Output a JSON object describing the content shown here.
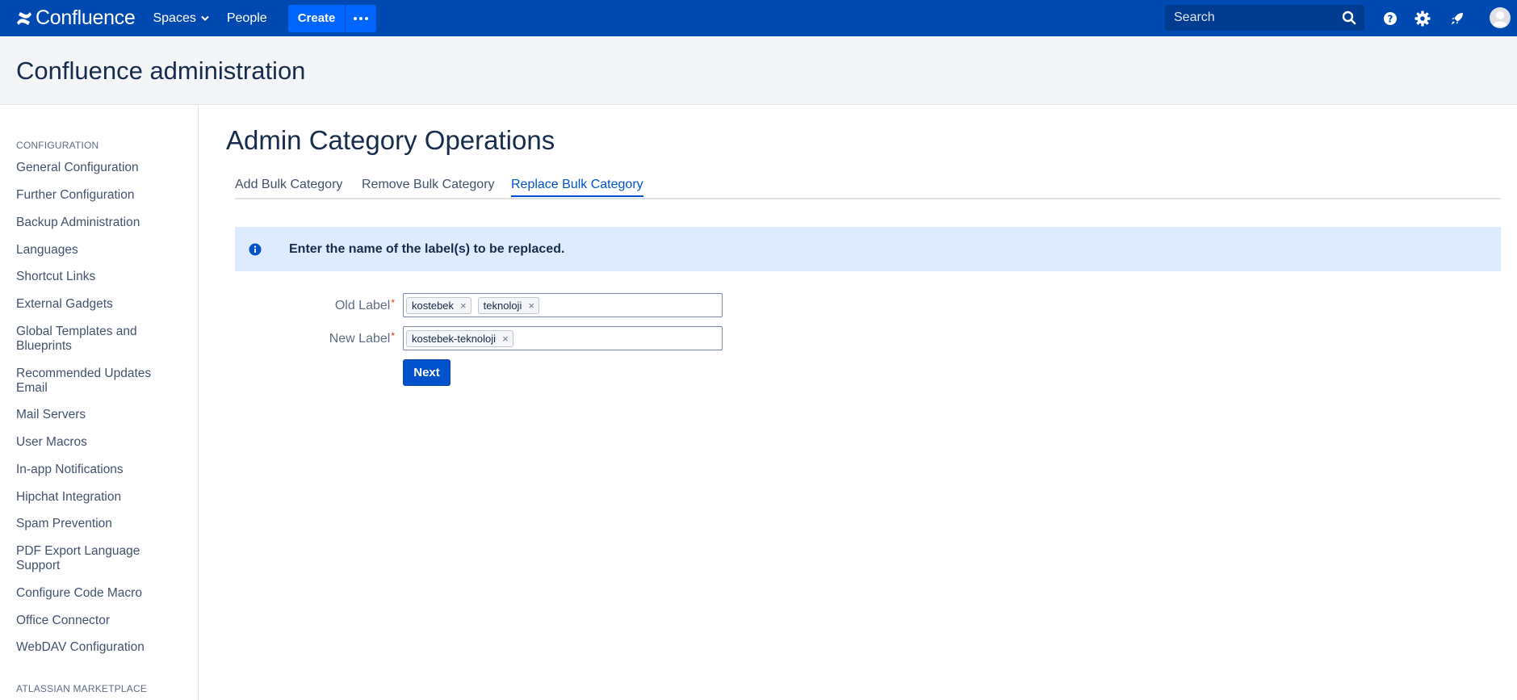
{
  "topnav": {
    "logo_text": "Confluence",
    "spaces_label": "Spaces",
    "people_label": "People",
    "create_label": "Create",
    "search_placeholder": "Search",
    "brand_color": "#0049b0"
  },
  "header": {
    "title": "Confluence administration"
  },
  "sidebar": {
    "configuration_heading": "CONFIGURATION",
    "items": [
      "General Configuration",
      "Further Configuration",
      "Backup Administration",
      "Languages",
      "Shortcut Links",
      "External Gadgets",
      "Global Templates and Blueprints",
      "Recommended Updates Email",
      "Mail Servers",
      "User Macros",
      "In-app Notifications",
      "Hipchat Integration",
      "Spam Prevention",
      "PDF Export Language Support",
      "Configure Code Macro",
      "Office Connector",
      "WebDAV Configuration"
    ],
    "marketplace_heading": "ATLASSIAN MARKETPLACE"
  },
  "main": {
    "page_title": "Admin Category Operations",
    "tabs": [
      {
        "label": "Add Bulk Category",
        "active": false
      },
      {
        "label": "Remove Bulk Category",
        "active": false
      },
      {
        "label": "Replace Bulk Category",
        "active": true
      }
    ],
    "info_message": "Enter the name of the label(s) to be replaced.",
    "old_label": {
      "label": "Old Label",
      "required_mark": "*",
      "tags": [
        "kostebek",
        "teknoloji"
      ]
    },
    "new_label": {
      "label": "New Label",
      "required_mark": "*",
      "tags": [
        "kostebek-teknoloji"
      ]
    },
    "tag_remove_glyph": "×",
    "next_label": "Next"
  }
}
